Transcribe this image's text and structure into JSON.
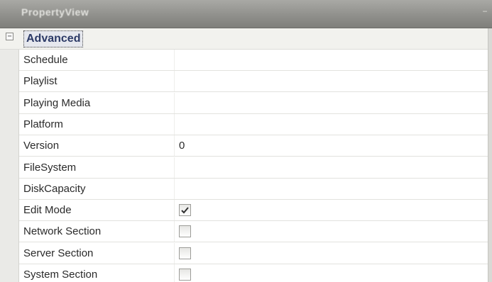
{
  "window": {
    "title": "PropertyView",
    "pin_glyph": "−"
  },
  "category": {
    "expander_glyph": "−",
    "label": "Advanced"
  },
  "properties": [
    {
      "name": "Schedule",
      "type": "text",
      "value": ""
    },
    {
      "name": "Playlist",
      "type": "text",
      "value": ""
    },
    {
      "name": "Playing Media",
      "type": "text",
      "value": ""
    },
    {
      "name": "Platform",
      "type": "text",
      "value": ""
    },
    {
      "name": "Version",
      "type": "text",
      "value": "0"
    },
    {
      "name": "FileSystem",
      "type": "text",
      "value": ""
    },
    {
      "name": "DiskCapacity",
      "type": "text",
      "value": ""
    },
    {
      "name": "Edit Mode",
      "type": "checkbox",
      "checked": true
    },
    {
      "name": "Network Section",
      "type": "checkbox",
      "checked": false
    },
    {
      "name": "Server Section",
      "type": "checkbox",
      "checked": false
    },
    {
      "name": "System Section",
      "type": "checkbox",
      "checked": false
    }
  ]
}
